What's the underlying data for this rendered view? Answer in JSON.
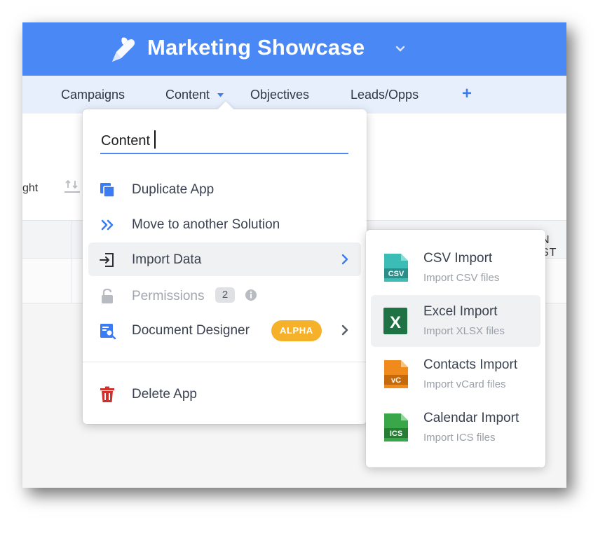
{
  "app": {
    "title": "Marketing Showcase"
  },
  "tabs": [
    {
      "label": "Campaigns"
    },
    {
      "label": "Content"
    },
    {
      "label": "Objectives"
    },
    {
      "label": "Leads/Opps"
    }
  ],
  "background": {
    "toolbar_fragment": "ght",
    "column_fragment": "N ST"
  },
  "app_menu": {
    "name_input_value": "Content",
    "items": [
      {
        "label": "Duplicate App",
        "icon": "duplicate-icon"
      },
      {
        "label": "Move to another Solution",
        "icon": "double-chevron-right-icon"
      },
      {
        "label": "Import Data",
        "icon": "import-icon"
      },
      {
        "label": "Permissions",
        "icon": "lock-icon",
        "count": "2"
      },
      {
        "label": "Document Designer",
        "icon": "document-designer-icon",
        "badge": "ALPHA"
      },
      {
        "label": "Delete App",
        "icon": "trash-icon"
      }
    ]
  },
  "import_submenu": {
    "items": [
      {
        "title": "CSV Import",
        "subtitle": "Import CSV files",
        "icon_label": "CSV",
        "color": "#3bbdb6"
      },
      {
        "title": "Excel Import",
        "subtitle": "Import XLSX files",
        "icon_label": "X",
        "color": "#1f7244"
      },
      {
        "title": "Contacts Import",
        "subtitle": "Import vCard files",
        "icon_label": "vC",
        "color": "#f08a1c"
      },
      {
        "title": "Calendar Import",
        "subtitle": "Import ICS files",
        "icon_label": "ICS",
        "color": "#3aa64a"
      }
    ]
  },
  "colors": {
    "header": "#4a89f5",
    "accent": "#3b7cf4",
    "danger": "#d0312d",
    "alpha_badge": "#f5b12a"
  }
}
